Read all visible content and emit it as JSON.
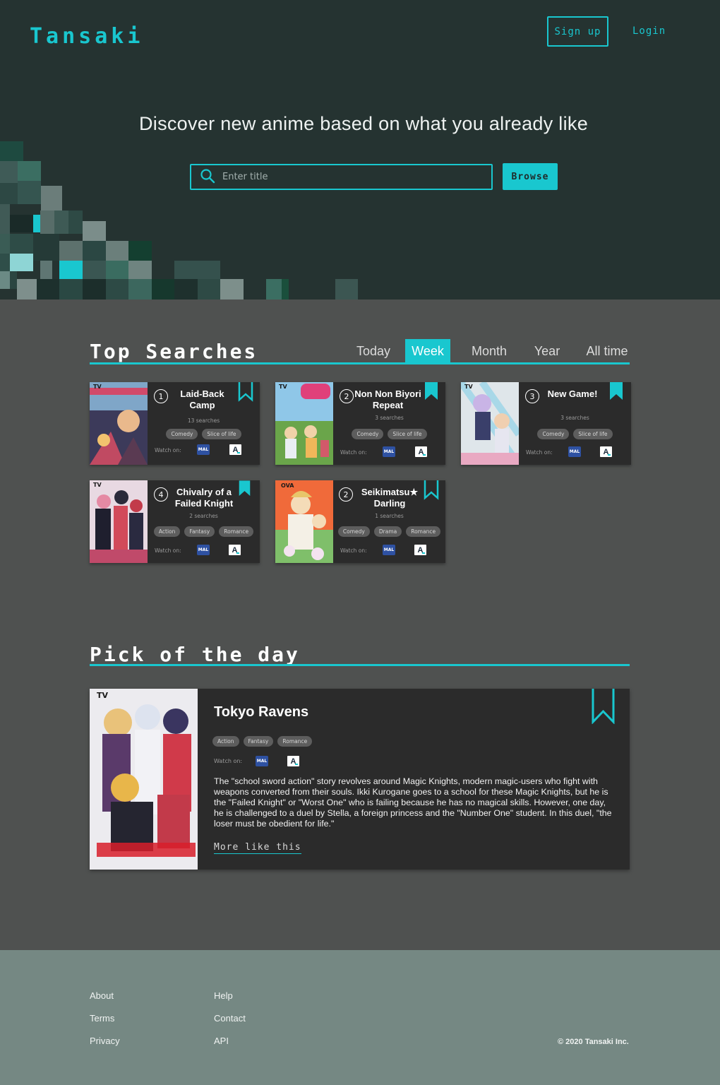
{
  "header": {
    "logo": "Tansaki",
    "signup_label": "Sign up",
    "login_label": "Login"
  },
  "hero": {
    "tagline": "Discover new anime based on what you already like",
    "search_placeholder": "Enter title",
    "browse_label": "Browse"
  },
  "top_searches": {
    "title": "Top Searches",
    "tabs": [
      {
        "label": "Today",
        "active": false
      },
      {
        "label": "Week",
        "active": true
      },
      {
        "label": "Month",
        "active": false
      },
      {
        "label": "Year",
        "active": false
      },
      {
        "label": "All time",
        "active": false
      }
    ],
    "watch_label": "Watch on:",
    "mal_label": "MAL",
    "anilist_label": "A",
    "cards": [
      {
        "rank": "1",
        "type": "TV",
        "title": "Laid-Back Camp",
        "count": "13 searches",
        "genres": [
          "Comedy",
          "Slice of life"
        ],
        "bookmarked": false
      },
      {
        "rank": "2",
        "type": "TV",
        "title": "Non Non Biyori Repeat",
        "count": "3 searches",
        "genres": [
          "Comedy",
          "Slice of life"
        ],
        "bookmarked": true
      },
      {
        "rank": "3",
        "type": "TV",
        "title": "New Game!",
        "count": "3 searches",
        "genres": [
          "Comedy",
          "Slice of life"
        ],
        "bookmarked": true
      },
      {
        "rank": "4",
        "type": "TV",
        "title": "Chivalry of a Failed Knight",
        "count": "2 searches",
        "genres": [
          "Action",
          "Fantasy",
          "Romance"
        ],
        "bookmarked": true
      },
      {
        "rank": "2",
        "type": "OVA",
        "title": "Seikimatsu★ Darling",
        "count": "1 searches",
        "genres": [
          "Comedy",
          "Drama",
          "Romance"
        ],
        "bookmarked": false
      }
    ]
  },
  "pick": {
    "title": "Pick of the day",
    "type": "TV",
    "name": "Tokyo Ravens",
    "genres": [
      "Action",
      "Fantasy",
      "Romance"
    ],
    "watch_label": "Watch on:",
    "mal_label": "MAL",
    "anilist_label": "A",
    "description": "The \"school sword action\" story revolves around Magic Knights, modern magic-users who fight with weapons converted from their souls. Ikki Kurogane goes to a school for these Magic Knights, but he is the \"Failed Knight\" or \"Worst One\" who is failing because he has no magical skills. However, one day, he is challenged to a duel by Stella, a foreign princess and the \"Number One\" student. In this duel, \"the loser must be obedient for life.\"",
    "more_label": "More like this"
  },
  "footer": {
    "col1": [
      "About",
      "Terms",
      "Privacy"
    ],
    "col2": [
      "Help",
      "Contact",
      "API"
    ],
    "copyright": "© 2020 Tansaki Inc."
  },
  "colors": {
    "accent": "#19c7cf",
    "hero_bg": "#253331",
    "body_bg": "#4f5150",
    "card_bg": "#2b2b2b",
    "footer_bg": "#758883"
  }
}
